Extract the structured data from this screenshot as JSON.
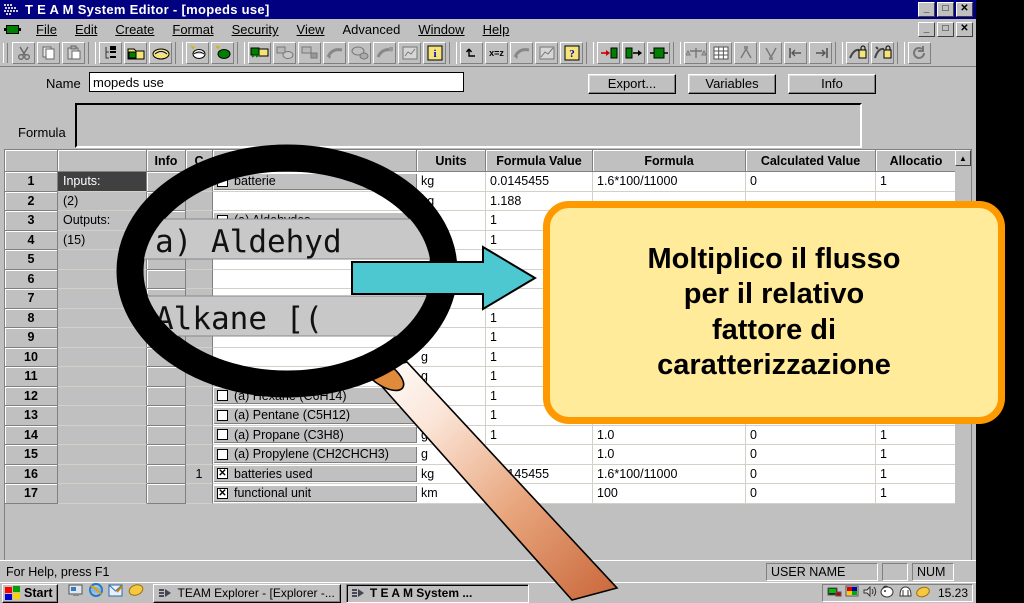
{
  "window": {
    "title": "T E A M System Editor - [mopeds use]",
    "app_icon": "team-app-icon",
    "minimize": "_",
    "maximize": "□",
    "close": "✕"
  },
  "menu": {
    "mdi_icon": "document-icon",
    "items": [
      {
        "label": "File",
        "accel": "F"
      },
      {
        "label": "Edit",
        "accel": "E"
      },
      {
        "label": "Create",
        "accel": "C"
      },
      {
        "label": "Format",
        "accel": "t"
      },
      {
        "label": "Security",
        "accel": "S"
      },
      {
        "label": "View",
        "accel": "V"
      },
      {
        "label": "Advanced",
        "accel": ""
      },
      {
        "label": "Window",
        "accel": "W"
      },
      {
        "label": "Help",
        "accel": "H"
      }
    ],
    "mdi_buttons": {
      "minimize": "_",
      "restore": "□",
      "close": "✕"
    }
  },
  "toolbar": {
    "buttons": [
      {
        "name": "cut-icon"
      },
      {
        "name": "copy-icon"
      },
      {
        "name": "paste-icon"
      },
      {
        "name": "tree-view-icon"
      },
      {
        "name": "open-folder-green-icon"
      },
      {
        "name": "folder-yellow-icon"
      },
      {
        "name": "new-process-white-icon"
      },
      {
        "name": "new-process-green-icon"
      },
      {
        "name": "system-green-icon"
      },
      {
        "name": "system-gray-icon"
      },
      {
        "name": "system-gray2-icon"
      },
      {
        "name": "tree-gray-icon"
      },
      {
        "name": "node-gray-icon"
      },
      {
        "name": "tree-gray2-icon"
      },
      {
        "name": "chart-gray-icon"
      },
      {
        "name": "info-blue-icon"
      },
      {
        "name": "input-flow-icon"
      },
      {
        "name": "output-flow-icon"
      },
      {
        "name": "process-box-icon"
      },
      {
        "name": "balance-icon"
      },
      {
        "name": "grid-icon"
      },
      {
        "name": "merge-up-icon"
      },
      {
        "name": "split-down-icon"
      },
      {
        "name": "align-left-icon"
      },
      {
        "name": "align-right-icon"
      },
      {
        "name": "lock-in-icon"
      },
      {
        "name": "lock-out-icon"
      },
      {
        "name": "refresh-icon"
      }
    ],
    "undo_label": "x=z"
  },
  "form": {
    "name_label": "Name",
    "name_value": "mopeds use",
    "name_placeholder": "",
    "formula_label": "Formula",
    "formula_value": "",
    "buttons": [
      {
        "id": "export",
        "label": "Export...",
        "accel": "x"
      },
      {
        "id": "variables",
        "label": "Variables",
        "accel": "a"
      },
      {
        "id": "info",
        "label": "Info",
        "accel": "I"
      }
    ]
  },
  "grid": {
    "columns": [
      "",
      "",
      "Info",
      "C",
      "",
      "Units",
      "Formula Value",
      "Formula",
      "Calculated Value",
      "Allocatio"
    ],
    "rows": [
      {
        "num": "1",
        "group": "Inputs:",
        "group_selected": true,
        "info": "",
        "count": "1",
        "checked": false,
        "flow": "batterie",
        "units": "kg",
        "formula_value": "0.0145455",
        "formula": "1.6*100/11000",
        "calculated": "0",
        "allocation": "1"
      },
      {
        "num": "2",
        "group": "(2)",
        "group_selected": false,
        "info": "",
        "count": "",
        "checked": false,
        "flow": "",
        "units": "kg",
        "formula_value": "1.188",
        "formula": "",
        "calculated": "",
        "allocation": ""
      },
      {
        "num": "3",
        "group": "Outputs:",
        "group_selected": false,
        "info": "",
        "count": "",
        "checked": false,
        "flow": "(a) Aldehydes",
        "units": "",
        "formula_value": "1",
        "formula": "",
        "calculated": "",
        "allocation": ""
      },
      {
        "num": "4",
        "group": "(15)",
        "group_selected": false,
        "info": "",
        "count": "",
        "checked": false,
        "flow": "(a) Alkane [C]",
        "units": "",
        "formula_value": "1",
        "formula": "",
        "calculated": "",
        "allocation": ""
      },
      {
        "num": "5",
        "group": "",
        "group_selected": false,
        "info": "",
        "count": "",
        "checked": false,
        "flow": "",
        "units": "",
        "formula_value": "",
        "formula": "",
        "calculated": "",
        "allocation": ""
      },
      {
        "num": "6",
        "group": "",
        "group_selected": false,
        "info": "",
        "count": "",
        "checked": false,
        "flow": "",
        "units": "",
        "formula_value": "",
        "formula": "",
        "calculated": "",
        "allocation": ""
      },
      {
        "num": "7",
        "group": "",
        "group_selected": false,
        "info": "",
        "count": "",
        "checked": false,
        "flow": "",
        "units": "",
        "formula_value": "1",
        "formula": "",
        "calculated": "",
        "allocation": ""
      },
      {
        "num": "8",
        "group": "",
        "group_selected": false,
        "info": "",
        "count": "",
        "checked": false,
        "flow": "",
        "units": "",
        "formula_value": "1",
        "formula": "",
        "calculated": "",
        "allocation": ""
      },
      {
        "num": "9",
        "group": "",
        "group_selected": false,
        "info": "",
        "count": "",
        "checked": false,
        "flow": "",
        "units": "",
        "formula_value": "1",
        "formula": "",
        "calculated": "",
        "allocation": ""
      },
      {
        "num": "10",
        "group": "",
        "group_selected": false,
        "info": "",
        "count": "",
        "checked": false,
        "flow": "",
        "units": "g",
        "formula_value": "1",
        "formula": "",
        "calculated": "",
        "allocation": ""
      },
      {
        "num": "11",
        "group": "",
        "group_selected": false,
        "info": "",
        "count": "",
        "checked": false,
        "flow": "",
        "units": "g",
        "formula_value": "1",
        "formula": "",
        "calculated": "",
        "allocation": ""
      },
      {
        "num": "12",
        "group": "",
        "group_selected": false,
        "info": "",
        "count": "",
        "checked": false,
        "flow": "(a) Hexane (C6H14)",
        "units": "",
        "formula_value": "1",
        "formula": "",
        "calculated": "",
        "allocation": ""
      },
      {
        "num": "13",
        "group": "",
        "group_selected": false,
        "info": "",
        "count": "",
        "checked": false,
        "flow": "(a) Pentane (C5H12)",
        "units": "",
        "formula_value": "1",
        "formula": "",
        "calculated": "",
        "allocation": ""
      },
      {
        "num": "14",
        "group": "",
        "group_selected": false,
        "info": "",
        "count": "",
        "checked": false,
        "flow": "(a) Propane (C3H8)",
        "units": "g",
        "formula_value": "1",
        "formula": "1.0",
        "calculated": "0",
        "allocation": "1"
      },
      {
        "num": "15",
        "group": "",
        "group_selected": false,
        "info": "",
        "count": "",
        "checked": false,
        "flow": "(a) Propylene (CH2CHCH3)",
        "units": "g",
        "formula_value": "",
        "formula": "1.0",
        "calculated": "0",
        "allocation": "1"
      },
      {
        "num": "16",
        "group": "",
        "group_selected": false,
        "info": "",
        "count": "1",
        "checked": true,
        "flow": "batteries used",
        "units": "kg",
        "formula_value": "0.0145455",
        "formula": "1.6*100/11000",
        "calculated": "0",
        "allocation": "1"
      },
      {
        "num": "17",
        "group": "",
        "group_selected": false,
        "info": "",
        "count": "",
        "checked": true,
        "flow": "functional unit",
        "units": "km",
        "formula_value": "",
        "formula": "100",
        "calculated": "0",
        "allocation": "1"
      }
    ]
  },
  "magnifier": {
    "line1": "a) Aldehyd",
    "line2": "Alkane [("
  },
  "callout": {
    "lines": [
      "Moltiplico il flusso",
      "per il relativo",
      "fattore di",
      "caratterizzazione"
    ],
    "fill_color": "#ffeb99",
    "border_color": "#ff9900"
  },
  "arrow": {
    "color": "#4ec8d0",
    "name": "pointer-arrow"
  },
  "statusbar": {
    "help_text": "For Help, press F1",
    "user_name": "USER NAME",
    "num_lock": "NUM"
  },
  "taskbar": {
    "start_label": "Start",
    "quick_launch": [
      {
        "name": "show-desktop-icon"
      },
      {
        "name": "internet-explorer-icon"
      },
      {
        "name": "outlook-express-icon"
      },
      {
        "name": "media-player-icon"
      }
    ],
    "tasks": [
      {
        "label": "TEAM Explorer - [Explorer -...",
        "active": false,
        "icon": "team-icon"
      },
      {
        "label": "T E A M System ...",
        "active": true,
        "icon": "team-icon"
      }
    ],
    "tray_icons": [
      {
        "name": "network-icon"
      },
      {
        "name": "display-icon"
      },
      {
        "name": "volume-icon"
      },
      {
        "name": "tray-misc1-icon"
      },
      {
        "name": "tray-misc2-icon"
      },
      {
        "name": "tray-misc3-icon"
      }
    ],
    "clock": "15.23"
  }
}
